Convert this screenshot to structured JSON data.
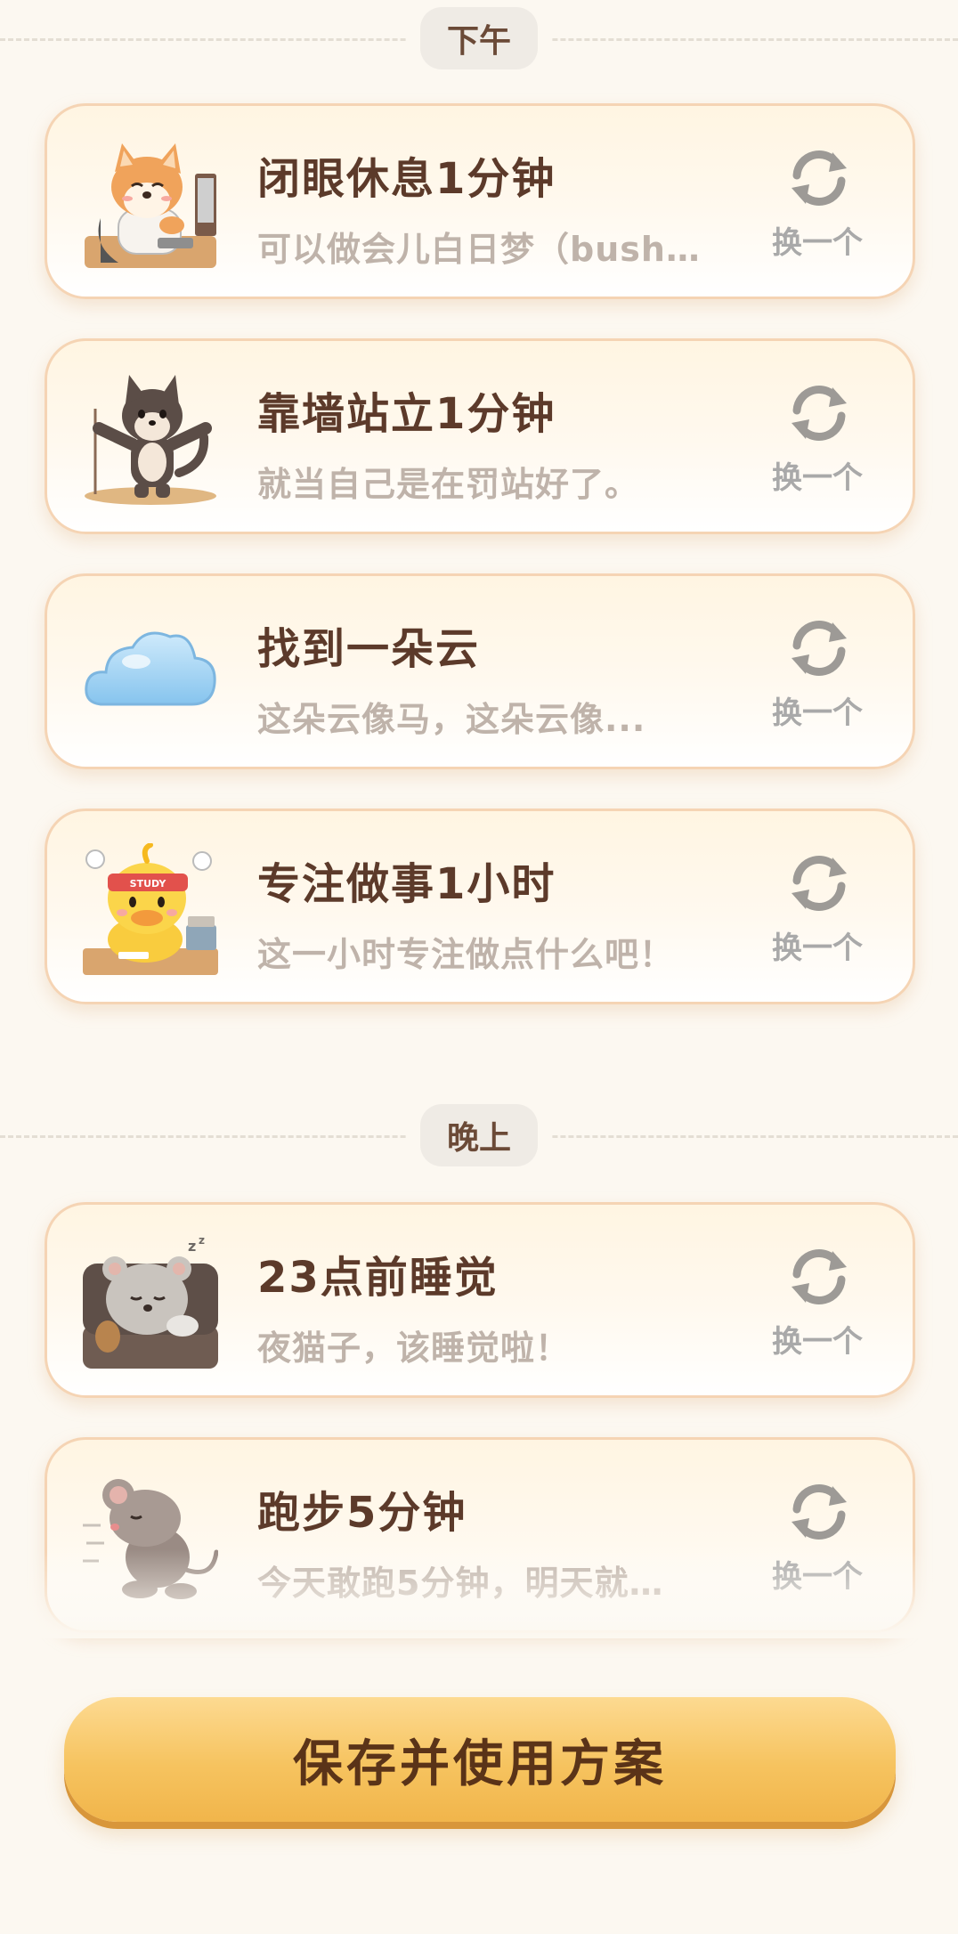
{
  "sections": [
    {
      "label": "下午",
      "items": [
        {
          "title": "闭眼休息1分钟",
          "desc": "可以做会儿白日梦（bush…",
          "swap_label": "换一个",
          "icon": "corgi-dog-at-desk"
        },
        {
          "title": "靠墙站立1分钟",
          "desc": "就当自己是在罚站好了。",
          "swap_label": "换一个",
          "icon": "husky-dog-standing"
        },
        {
          "title": "找到一朵云",
          "desc": "这朵云像马，这朵云像...",
          "swap_label": "换一个",
          "icon": "cloud"
        },
        {
          "title": "专注做事1小时",
          "desc": "这一小时专注做点什么吧！",
          "swap_label": "换一个",
          "icon": "duck-studying",
          "headband_text": "STUDY"
        }
      ]
    },
    {
      "label": "晚上",
      "items": [
        {
          "title": "23点前睡觉",
          "desc": "夜猫子，该睡觉啦！",
          "swap_label": "换一个",
          "icon": "sleepy-bear-in-bed"
        },
        {
          "title": "跑步5分钟",
          "desc": "今天敢跑5分钟，明天就…",
          "swap_label": "换一个",
          "icon": "running-mouse"
        }
      ]
    }
  ],
  "footer": {
    "cta_label": "保存并使用方案"
  },
  "colors": {
    "background": "#FCF8F1",
    "title": "#5C3A2A",
    "desc": "#BFB3AA",
    "card_border": "#F5D4B4",
    "cta": "#F6C35F",
    "swap": "#A9A9A9"
  }
}
